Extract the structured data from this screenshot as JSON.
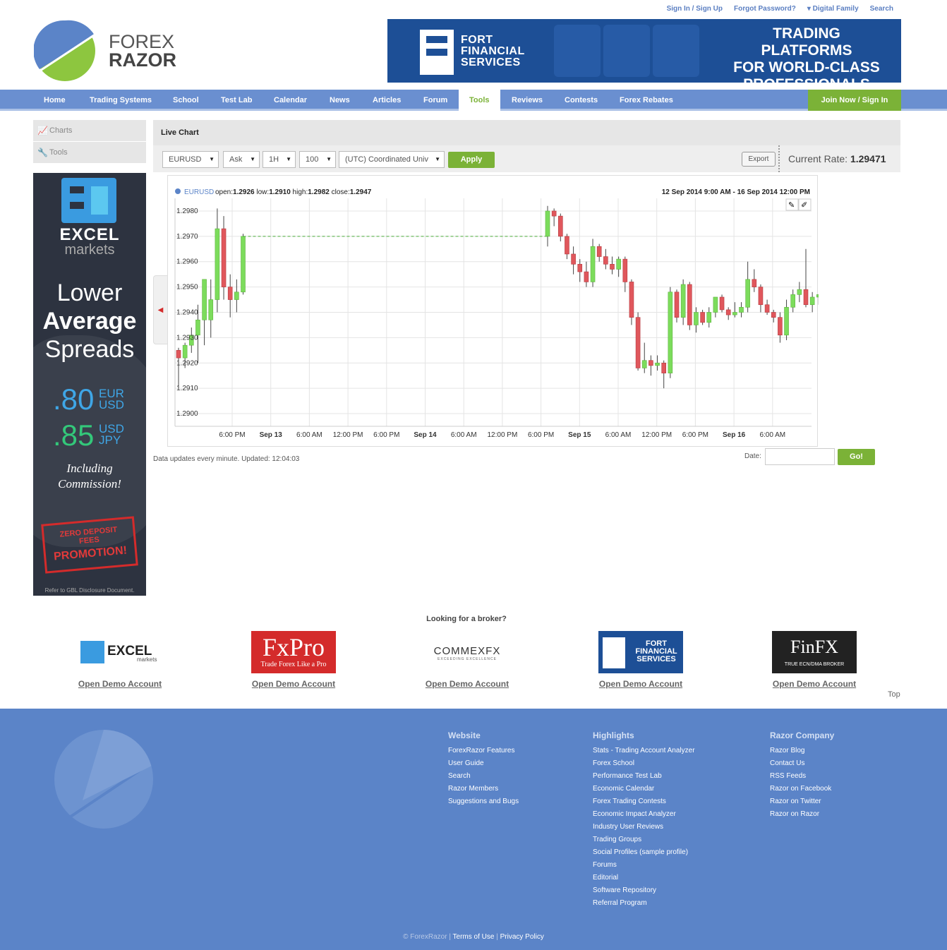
{
  "top_links": [
    "Sign In / Sign Up",
    "Forgot Password?",
    "▾ Digital Family",
    "Search"
  ],
  "logo": {
    "line1": "FOREX",
    "line2": "RAZOR"
  },
  "banner": {
    "brand_lines": [
      "FORT",
      "FINANCIAL",
      "SERVICES"
    ],
    "headline_lines": [
      "TRADING PLATFORMS",
      "FOR WORLD-CLASS",
      "PROFESSIONALS"
    ]
  },
  "nav": {
    "items": [
      "Home",
      "Trading Systems",
      "School",
      "Test Lab",
      "Calendar",
      "News",
      "Articles",
      "Forum",
      "Tools",
      "Reviews",
      "Contests",
      "Forex Rebates"
    ],
    "active": "Tools",
    "join": "Join Now / Sign In"
  },
  "sidebar": {
    "items": [
      "Charts",
      "Tools"
    ]
  },
  "ad": {
    "brand": "EXCEL",
    "brand_sub": "markets",
    "tag_lines": [
      "Lower",
      "Average",
      "Spreads"
    ],
    "spread1": ".80",
    "pair1_top": "EUR",
    "pair1_bottom": "USD",
    "spread2": ".85",
    "pair2_top": "USD",
    "pair2_bottom": "JPY",
    "including_lines": [
      "Including",
      "Commission!"
    ],
    "stamp_lines": [
      "ZERO DEPOSIT",
      "FEES",
      "PROMOTION!"
    ],
    "disclaimer": "Refer to GBL Disclosure Document."
  },
  "panel": {
    "title": "Live Chart",
    "symbol": "EURUSD",
    "price_type": "Ask",
    "timeframe": "1H",
    "count": "100",
    "timezone": "(UTC) Coordinated Univ",
    "apply": "Apply",
    "export": "Export",
    "rate_label": "Current Rate:",
    "rate_value": "1.29471",
    "status": "Data updates every minute. Updated: 12:04:03",
    "date_label": "Date:",
    "go": "Go!"
  },
  "chart_data": {
    "type": "candlestick",
    "symbol": "EURUSD",
    "summary": {
      "open": "1.2926",
      "low": "1.2910",
      "high": "1.2982",
      "close": "1.2947"
    },
    "range_label": "12 Sep 2014 9:00 AM - 16 Sep 2014 12:00 PM",
    "ylim": [
      1.2895,
      1.2985
    ],
    "yticks": [
      "1.2980",
      "1.2970",
      "1.2960",
      "1.2950",
      "1.2940",
      "1.2930",
      "1.2920",
      "1.2910",
      "1.2900"
    ],
    "xticks": [
      {
        "label": "6:00 PM",
        "bold": false
      },
      {
        "label": "Sep 13",
        "bold": true
      },
      {
        "label": "6:00 AM",
        "bold": false
      },
      {
        "label": "12:00 PM",
        "bold": false
      },
      {
        "label": "6:00 PM",
        "bold": false
      },
      {
        "label": "Sep 14",
        "bold": true
      },
      {
        "label": "6:00 AM",
        "bold": false
      },
      {
        "label": "12:00 PM",
        "bold": false
      },
      {
        "label": "6:00 PM",
        "bold": false
      },
      {
        "label": "Sep 15",
        "bold": true
      },
      {
        "label": "6:00 AM",
        "bold": false
      },
      {
        "label": "12:00 PM",
        "bold": false
      },
      {
        "label": "6:00 PM",
        "bold": false
      },
      {
        "label": "Sep 16",
        "bold": true
      },
      {
        "label": "6:00 AM",
        "bold": false
      }
    ],
    "candles_part1": [
      [
        1.2925,
        1.2926,
        1.291,
        1.2922
      ],
      [
        1.2922,
        1.2928,
        1.2918,
        1.2927
      ],
      [
        1.2927,
        1.2934,
        1.2924,
        1.2931
      ],
      [
        1.2931,
        1.2943,
        1.292,
        1.2937
      ],
      [
        1.2937,
        1.2948,
        1.2927,
        1.2953
      ],
      [
        1.2937,
        1.2953,
        1.293,
        1.2945
      ],
      [
        1.2945,
        1.2981,
        1.294,
        1.2973
      ],
      [
        1.2973,
        1.2978,
        1.2945,
        1.295
      ],
      [
        1.295,
        1.2955,
        1.2938,
        1.2945
      ],
      [
        1.2945,
        1.2953,
        1.294,
        1.2948
      ],
      [
        1.2948,
        1.2971,
        1.2947,
        1.297
      ]
    ],
    "gap_level": 1.297,
    "candles_part2": [
      [
        1.297,
        1.2982,
        1.2966,
        1.298
      ],
      [
        1.298,
        1.2981,
        1.2974,
        1.2978
      ],
      [
        1.2978,
        1.2979,
        1.2968,
        1.297
      ],
      [
        1.297,
        1.2971,
        1.2961,
        1.2963
      ],
      [
        1.2963,
        1.2966,
        1.2955,
        1.2959
      ],
      [
        1.2959,
        1.2961,
        1.2952,
        1.2956
      ],
      [
        1.2956,
        1.296,
        1.295,
        1.2952
      ],
      [
        1.2952,
        1.2969,
        1.295,
        1.2966
      ],
      [
        1.2966,
        1.2967,
        1.296,
        1.2962
      ],
      [
        1.2962,
        1.2965,
        1.2957,
        1.2959
      ],
      [
        1.2959,
        1.2962,
        1.2955,
        1.2957
      ],
      [
        1.2957,
        1.2962,
        1.2954,
        1.2961
      ],
      [
        1.2961,
        1.2962,
        1.2948,
        1.2952
      ],
      [
        1.2952,
        1.2953,
        1.2935,
        1.2938
      ],
      [
        1.2938,
        1.294,
        1.2917,
        1.2918
      ],
      [
        1.2918,
        1.2928,
        1.2916,
        1.2921
      ],
      [
        1.2921,
        1.2923,
        1.2915,
        1.2919
      ],
      [
        1.2919,
        1.2923,
        1.2917,
        1.292
      ],
      [
        1.292,
        1.2921,
        1.291,
        1.2916
      ],
      [
        1.2916,
        1.295,
        1.2914,
        1.2948
      ],
      [
        1.2948,
        1.2949,
        1.2936,
        1.2938
      ],
      [
        1.2938,
        1.2953,
        1.2935,
        1.2951
      ],
      [
        1.2951,
        1.2952,
        1.2933,
        1.2935
      ],
      [
        1.2935,
        1.2942,
        1.2932,
        1.294
      ],
      [
        1.294,
        1.2941,
        1.2935,
        1.2936
      ],
      [
        1.2936,
        1.2942,
        1.2934,
        1.294
      ],
      [
        1.294,
        1.2946,
        1.2938,
        1.2946
      ],
      [
        1.2946,
        1.2947,
        1.294,
        1.2941
      ],
      [
        1.2941,
        1.2942,
        1.2937,
        1.2939
      ],
      [
        1.2939,
        1.2944,
        1.2938,
        1.294
      ],
      [
        1.294,
        1.2944,
        1.2938,
        1.2942
      ],
      [
        1.2942,
        1.296,
        1.294,
        1.2953
      ],
      [
        1.2953,
        1.2957,
        1.2948,
        1.295
      ],
      [
        1.295,
        1.2951,
        1.294,
        1.2943
      ],
      [
        1.2943,
        1.2945,
        1.2939,
        1.294
      ],
      [
        1.294,
        1.2941,
        1.2936,
        1.2938
      ],
      [
        1.2938,
        1.294,
        1.2928,
        1.2931
      ],
      [
        1.2931,
        1.2945,
        1.2929,
        1.2942
      ],
      [
        1.2942,
        1.2949,
        1.294,
        1.2947
      ],
      [
        1.2947,
        1.2952,
        1.2944,
        1.2949
      ],
      [
        1.2949,
        1.2965,
        1.2942,
        1.2943
      ],
      [
        1.2943,
        1.2948,
        1.294,
        1.2946
      ],
      [
        1.2946,
        1.2947,
        1.2943,
        1.2947
      ]
    ]
  },
  "brokers": {
    "heading": "Looking for a broker?",
    "items": [
      {
        "name": "EXCEL",
        "sub": "markets",
        "cta": "Open Demo Account"
      },
      {
        "name": "FxPro",
        "sub": "Trade Forex Like a Pro",
        "cta": "Open Demo Account"
      },
      {
        "name": "COMMEXFX",
        "sub": "EXCEEDING EXCELLENCE",
        "cta": "Open Demo Account"
      },
      {
        "name": "FORT FINANCIAL SERVICES",
        "sub": "",
        "cta": "Open Demo Account"
      },
      {
        "name": "FinFX",
        "sub": "TRUE ECN/DMA BROKER",
        "cta": "Open Demo Account"
      }
    ],
    "top": "Top"
  },
  "footer": {
    "cols": [
      {
        "title": "Website",
        "links": [
          "ForexRazor Features",
          "User Guide",
          "Search",
          "Razor Members",
          "Suggestions and Bugs"
        ]
      },
      {
        "title": "Highlights",
        "links": [
          "Stats - Trading Account Analyzer",
          "Forex School",
          "Performance Test Lab",
          "Economic Calendar",
          "Forex Trading Contests",
          "Economic Impact Analyzer",
          "Industry User Reviews",
          "Trading Groups",
          "Social Profiles (sample profile)",
          "Forums",
          "Editorial",
          "Software Repository",
          "Referral Program"
        ]
      },
      {
        "title": "Razor Company",
        "links": [
          "Razor Blog",
          "Contact Us",
          "RSS Feeds",
          "Razor on Facebook",
          "Razor on Twitter",
          "Razor on Razor"
        ]
      }
    ],
    "copyright": "© ForexRazor",
    "terms": "Terms of Use",
    "privacy": "Privacy Policy"
  },
  "colors": {
    "nav": "#6a8fd0",
    "green": "#7bb237",
    "footer": "#5b84c8",
    "bull": "#7cdc5c",
    "bear": "#e0575c"
  }
}
